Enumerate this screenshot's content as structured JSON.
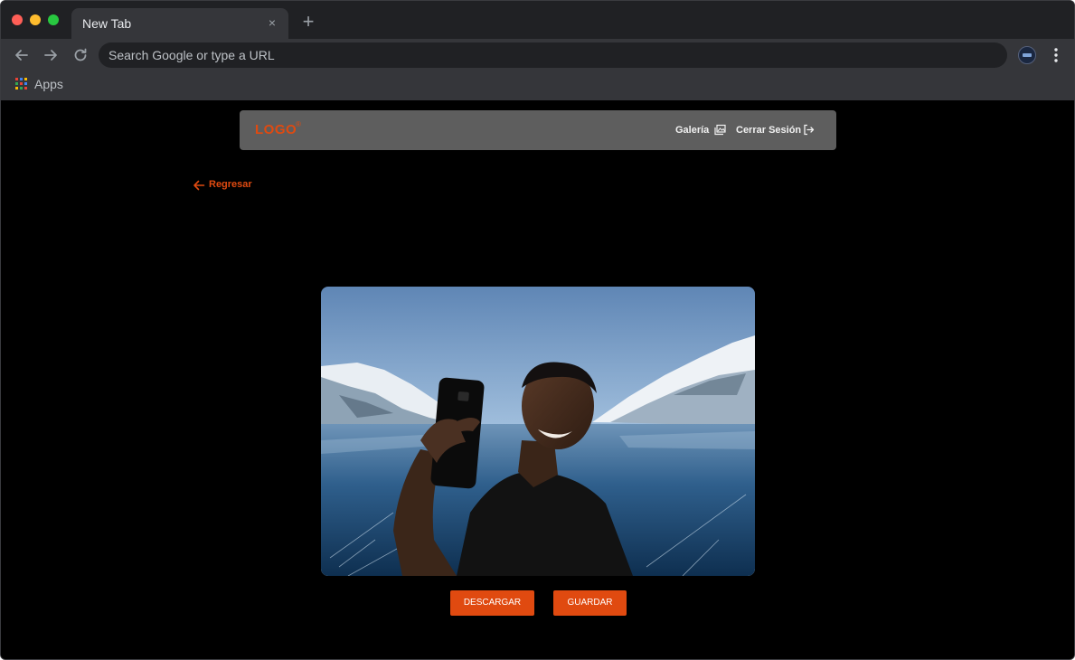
{
  "browser": {
    "tab_title": "New Tab",
    "tab_close_glyph": "×",
    "new_tab_glyph": "+",
    "omnibox_placeholder": "Search Google or type a URL",
    "bookmarks": {
      "apps_label": "Apps"
    }
  },
  "app": {
    "logo": "LOGO",
    "logo_mark": "®",
    "nav": {
      "gallery_label": "Galería",
      "logout_label": "Cerrar Sesión"
    },
    "back_label": "Regresar",
    "actions": {
      "download_label": "DESCARGAR",
      "save_label": "GUARDAR"
    }
  },
  "colors": {
    "accent": "#e04a10",
    "header_bg": "#5e5e5e",
    "page_bg": "#000000",
    "chrome_dark": "#202124",
    "chrome_mid": "#35363a"
  },
  "icons": {
    "back": "arrow-left-icon",
    "forward": "arrow-right-icon",
    "reload": "reload-icon",
    "menu": "kebab-menu-icon",
    "apps": "apps-grid-icon",
    "gallery": "image-gallery-icon",
    "logout": "logout-icon",
    "page_back": "arrow-left-icon"
  }
}
